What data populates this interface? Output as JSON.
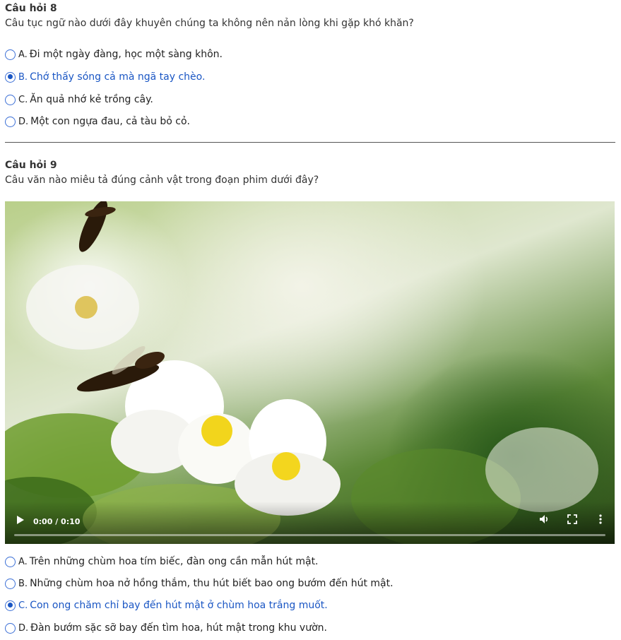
{
  "q8": {
    "title": "Câu hỏi 8",
    "text": "Câu tục ngữ nào dưới đây khuyên chúng ta không nên nản lòng khi gặp khó khăn?",
    "options": [
      {
        "letter": "A.",
        "text": "Đi một ngày đàng, học một sàng khôn.",
        "selected": false
      },
      {
        "letter": "B.",
        "text": "Chớ thấy sóng cả mà ngã tay chèo.",
        "selected": true
      },
      {
        "letter": "C.",
        "text": "Ăn quả nhớ kẻ trồng cây.",
        "selected": false
      },
      {
        "letter": "D.",
        "text": "Một con ngựa đau, cả tàu bỏ cỏ.",
        "selected": false
      }
    ]
  },
  "q9": {
    "title": "Câu hỏi 9",
    "text": "Câu văn nào miêu tả đúng cảnh vật trong đoạn phim dưới đây?",
    "video": {
      "time": "0:00 / 0:10",
      "play_icon": "play-icon",
      "volume_icon": "volume-icon",
      "fullscreen_icon": "fullscreen-icon",
      "more_icon": "more-vert-icon",
      "progress": 0
    },
    "options": [
      {
        "letter": "A.",
        "text": "Trên những chùm hoa tím biếc, đàn ong cần mẫn hút mật.",
        "selected": false
      },
      {
        "letter": "B.",
        "text": "Những chùm hoa nở hồng thắm, thu hút biết bao ong bướm đến hút mật.",
        "selected": false
      },
      {
        "letter": "C.",
        "text": "Con ong chăm chỉ bay đến hút mật ở chùm hoa trắng muốt.",
        "selected": true
      },
      {
        "letter": "D.",
        "text": "Đàn bướm sặc sỡ bay đến tìm hoa, hút mật trong khu vườn.",
        "selected": false
      }
    ]
  },
  "colors": {
    "accent": "#1a56c4",
    "radio_border": "#3b6fd6"
  }
}
